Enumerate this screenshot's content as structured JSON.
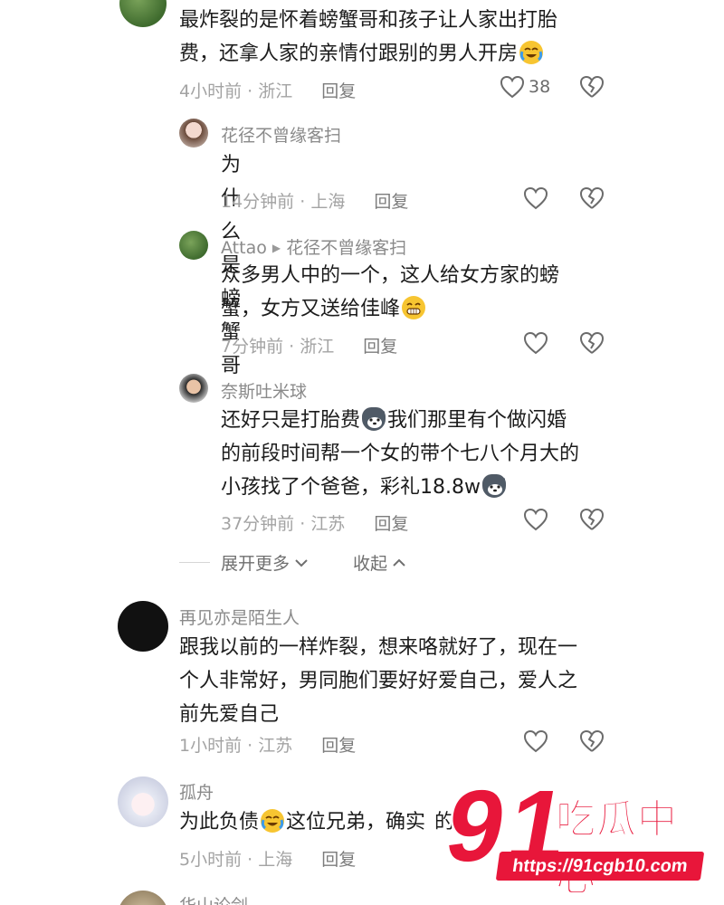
{
  "comments": [
    {
      "id": "c0",
      "text": "最炸裂的是怀着螃蟹哥和孩子让人家出打胎费，还拿人家的亲情付跟别的男人开房",
      "text_l1": "最炸裂的是怀着螃蟹哥和孩子让人家出打胎",
      "text_l2": "费，还拿人家的亲情付跟别的男人开房",
      "time": "4小时前",
      "location": "浙江",
      "reply": "回复",
      "likes": "38"
    },
    {
      "id": "c1",
      "username": "花径不曾缘客扫",
      "text": "为什么是螃蟹哥",
      "time": "14分钟前",
      "location": "上海",
      "reply": "回复"
    },
    {
      "id": "c2",
      "username": "Attao",
      "reply_to": "花径不曾缘客扫",
      "text_l1": "众多男人中的一个，这人给女方家的螃",
      "text_l2": "蟹，女方又送给佳峰",
      "time": "7分钟前",
      "location": "浙江",
      "reply": "回复"
    },
    {
      "id": "c3",
      "username": "奈斯吐米球",
      "text_l1a": "还好只是打胎费",
      "text_l1b": "我们那里有个做闪婚",
      "text_l2": "的前段时间帮一个女的带个七八个月大的",
      "text_l3": "小孩找了个爸爸，彩礼18.8w",
      "time": "37分钟前",
      "location": "江苏",
      "reply": "回复"
    },
    {
      "id": "c4",
      "username": "再见亦是陌生人",
      "text_l1": "跟我以前的一样炸裂，想来咯就好了，现在一",
      "text_l2": "个人非常好，男同胞们要好好爱自己，爱人之",
      "text_l3": "前先爱自己",
      "time": "1小时前",
      "location": "江苏",
      "reply": "回复"
    },
    {
      "id": "c5",
      "username": "孤舟",
      "text_a": "为此负债",
      "text_b": "这位兄弟，确实",
      "text_c": "的",
      "time": "5小时前",
      "location": "上海",
      "reply": "回复"
    },
    {
      "id": "c6",
      "username": "华山论剑"
    }
  ],
  "fold": {
    "expand": "展开更多",
    "collapse": "收起"
  },
  "watermark": {
    "logo_number": "91",
    "logo_text": "吃瓜中心",
    "url": "https://91cgb10.com"
  },
  "colors": {
    "brand_red": "#e8163a",
    "meta_gray": "#a3a3a3"
  }
}
